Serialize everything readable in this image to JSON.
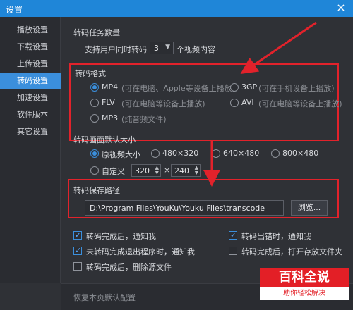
{
  "window": {
    "title": "设置",
    "close_label": "×"
  },
  "sidebar": {
    "items": [
      {
        "label": "播放设置",
        "active": false
      },
      {
        "label": "下载设置",
        "active": false
      },
      {
        "label": "上传设置",
        "active": false
      },
      {
        "label": "转码设置",
        "active": true
      },
      {
        "label": "加速设置",
        "active": false
      },
      {
        "label": "软件版本",
        "active": false
      },
      {
        "label": "其它设置",
        "active": false
      }
    ]
  },
  "task_count": {
    "title": "转码任务数量",
    "prefix": "支持用户同时转码",
    "value": "3",
    "suffix": "个视频内容"
  },
  "format": {
    "title": "转码格式",
    "options": [
      {
        "label": "MP4",
        "desc": "(可在电脑、Apple等设备上播放)",
        "selected": true
      },
      {
        "label": "3GP",
        "desc": "(可在手机设备上播放)",
        "selected": false
      },
      {
        "label": "FLV",
        "desc": "(可在电脑等设备上播放)",
        "selected": false
      },
      {
        "label": "AVI",
        "desc": "(可在电脑等设备上播放)",
        "selected": false
      },
      {
        "label": "MP3",
        "desc": "(纯音频文件)",
        "selected": false
      }
    ]
  },
  "size": {
    "title": "转码画面默认大小",
    "options": [
      {
        "label": "原视频大小",
        "selected": true
      },
      {
        "label": "480×320",
        "selected": false
      },
      {
        "label": "640×480",
        "selected": false
      },
      {
        "label": "800×480",
        "selected": false
      }
    ],
    "custom_label": "自定义",
    "width": "320",
    "times": "×",
    "height": "240"
  },
  "save_path": {
    "title": "转码保存路径",
    "value": "D:\\Program Files\\YouKu\\Youku Files\\transcode",
    "browse_label": "浏览..."
  },
  "options": [
    {
      "label": "转码完成后，通知我",
      "checked": true
    },
    {
      "label": "转码出错时，通知我",
      "checked": true
    },
    {
      "label": "未转码完成退出程序时，通知我",
      "checked": true
    },
    {
      "label": "转码完成后，打开存放文件夹",
      "checked": false
    },
    {
      "label": "转码完成后，删除源文件",
      "checked": false
    }
  ],
  "footer": {
    "reset_label": "恢复本页默认配置"
  },
  "watermark": {
    "title": "百科全说",
    "subtitle": "助你轻松解决"
  },
  "colors": {
    "titlebar": "#1f86d8",
    "accent": "#3b8fdc",
    "annotation": "#e2222b"
  }
}
